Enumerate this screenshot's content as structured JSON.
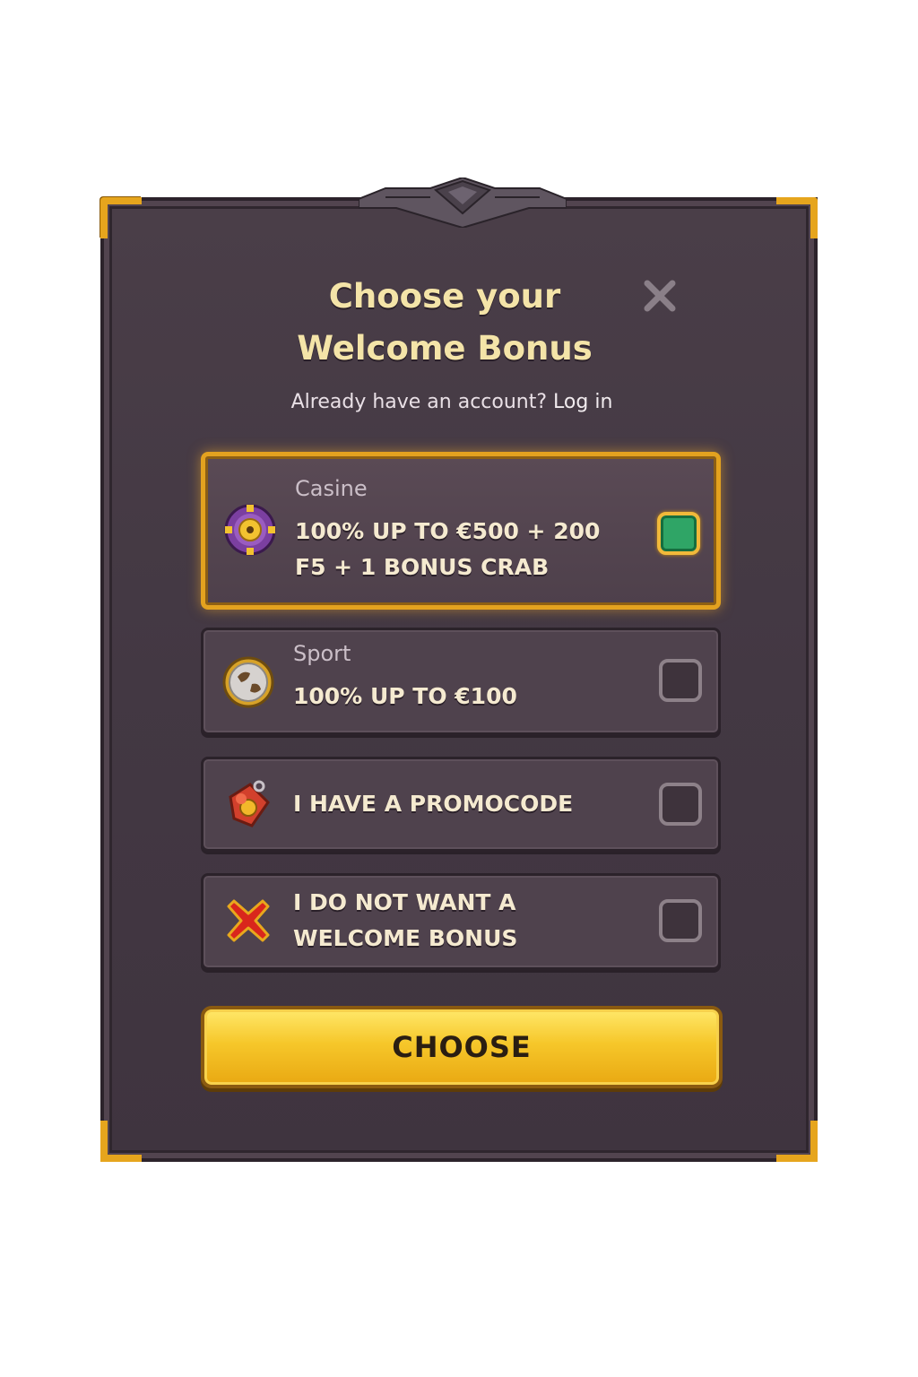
{
  "modal": {
    "title": "Choose your Welcome Bonus",
    "close_icon": "close-icon",
    "subtitle_prefix": "Already have an account?",
    "login_link": "Log in"
  },
  "options": [
    {
      "category": "Casine",
      "text": "100% UP TO €500 + 200 F5 + 1 BONUS CRAB",
      "icon": "casino-chip-icon",
      "selected": true
    },
    {
      "category": "Sport",
      "text": "100% UP TO €100",
      "icon": "ball-icon",
      "selected": false
    },
    {
      "category": "",
      "text": "I HAVE A PROMOCODE",
      "icon": "promo-tag-icon",
      "selected": false
    },
    {
      "category": "",
      "text": "I DO NOT WANT A WELCOME BONUS",
      "icon": "red-x-icon",
      "selected": false
    }
  ],
  "choose_button": {
    "label": "CHOOSE"
  },
  "colors": {
    "panel": "#463a45",
    "gold_border": "#e3a21f",
    "title": "#f4e4a8",
    "check_green": "#2fa566"
  }
}
